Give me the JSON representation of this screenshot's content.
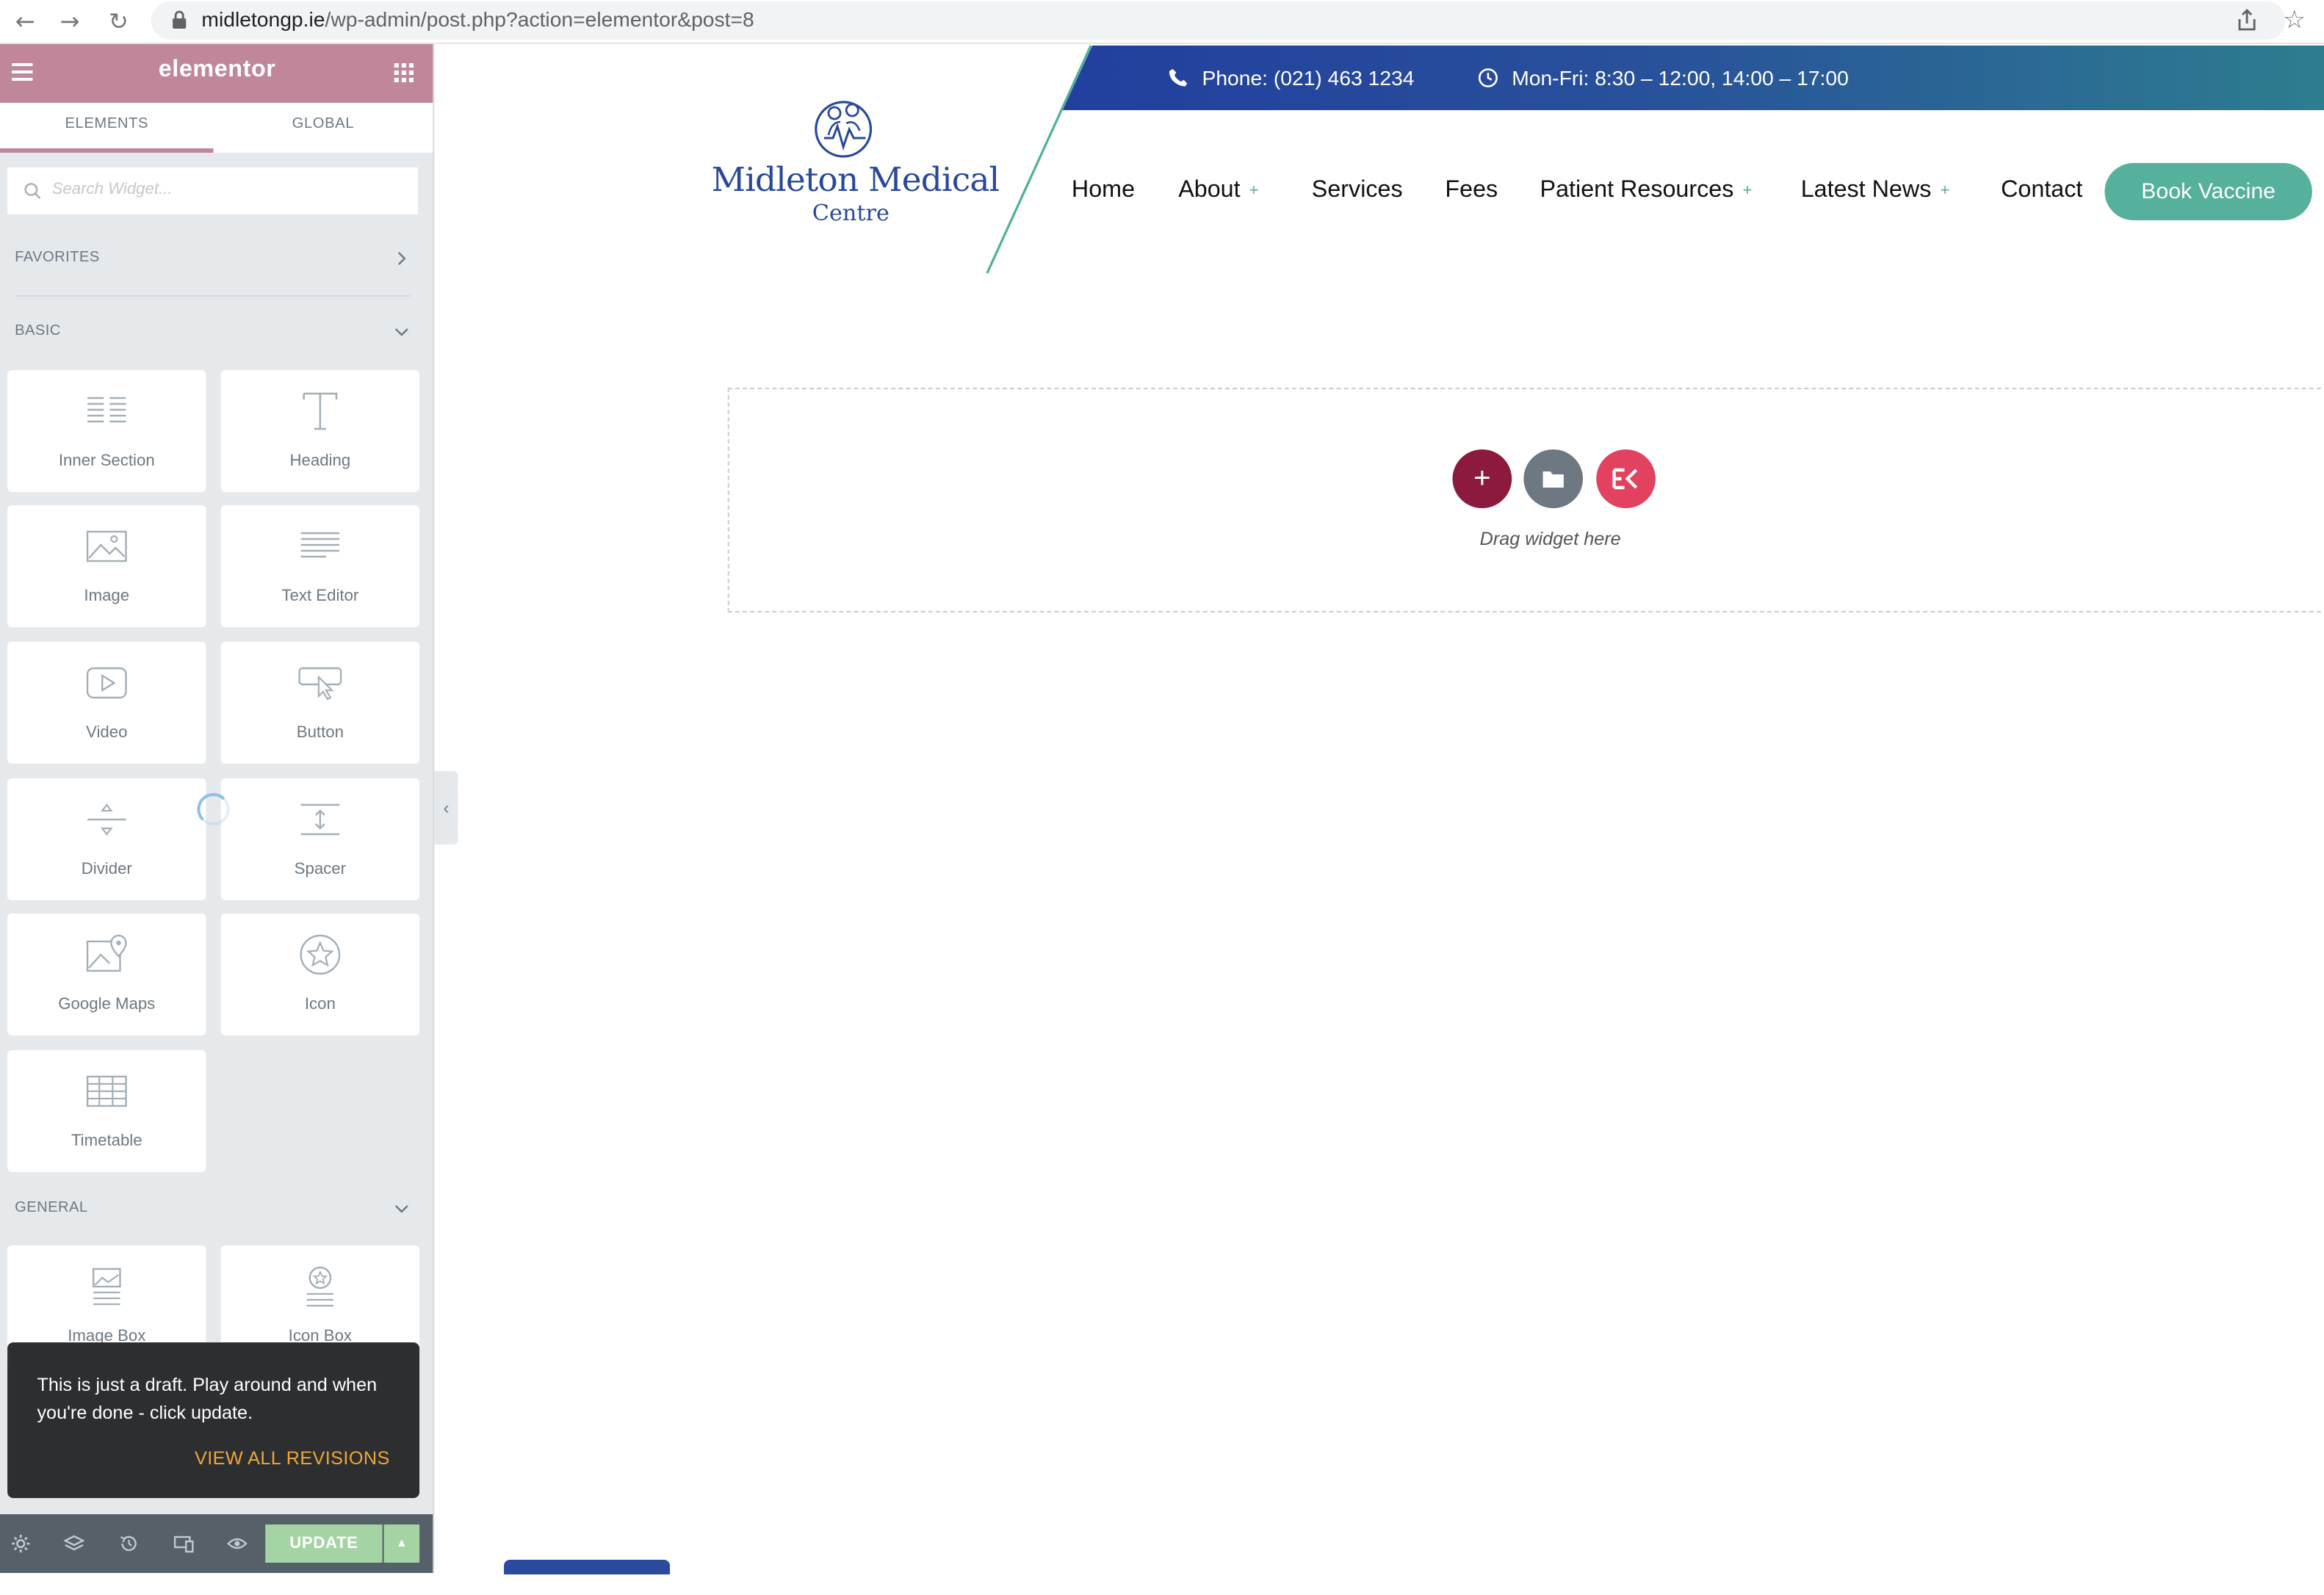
{
  "browser": {
    "url_host": "midletongp.ie",
    "url_path": "/wp-admin/post.php?action=elementor&post=8"
  },
  "panel": {
    "brand": "elementor",
    "tabs": [
      "ELEMENTS",
      "GLOBAL"
    ],
    "search_placeholder": "Search Widget...",
    "categories": {
      "favorites": "FAVORITES",
      "basic": "BASIC",
      "general": "GENERAL"
    },
    "basic_widgets": [
      {
        "label": "Inner Section",
        "icon": "inner-section-icon"
      },
      {
        "label": "Heading",
        "icon": "heading-icon"
      },
      {
        "label": "Image",
        "icon": "image-icon"
      },
      {
        "label": "Text Editor",
        "icon": "text-editor-icon"
      },
      {
        "label": "Video",
        "icon": "video-icon"
      },
      {
        "label": "Button",
        "icon": "button-icon"
      },
      {
        "label": "Divider",
        "icon": "divider-icon"
      },
      {
        "label": "Spacer",
        "icon": "spacer-icon"
      },
      {
        "label": "Google Maps",
        "icon": "google-maps-icon"
      },
      {
        "label": "Icon",
        "icon": "star-icon"
      },
      {
        "label": "Timetable",
        "icon": "timetable-icon"
      }
    ],
    "general_widgets": [
      {
        "label": "Image Box",
        "icon": "image-box-icon"
      },
      {
        "label": "Icon Box",
        "icon": "icon-box-icon"
      }
    ],
    "toast": {
      "message": "This is just a draft. Play around and when you're done - click update.",
      "link": "VIEW ALL REVISIONS"
    },
    "footer": {
      "update_label": "UPDATE"
    },
    "accent_color": "#c0879b"
  },
  "site": {
    "logo_title": "Midleton Medical",
    "logo_subtitle": "Centre",
    "phone": "Phone: (021) 463 1234",
    "hours": "Mon-Fri: 8:30 – 12:00, 14:00 – 17:00",
    "menu": [
      {
        "label": "Home",
        "has_submenu": false
      },
      {
        "label": "About",
        "has_submenu": true
      },
      {
        "label": "Services",
        "has_submenu": false
      },
      {
        "label": "Fees",
        "has_submenu": false
      },
      {
        "label": "Patient Resources",
        "has_submenu": true
      },
      {
        "label": "Latest News",
        "has_submenu": true
      },
      {
        "label": "Contact",
        "has_submenu": false
      }
    ],
    "submenu_marker": "+",
    "cta": "Book Vaccine",
    "brand_blue": "#28499a",
    "brand_teal": "#55b09c"
  },
  "canvas": {
    "drop_hint": "Drag widget here",
    "add_button_color": "#8b1a3d",
    "template_button_color": "#6d7882",
    "kit_button_color": "#e2415f"
  }
}
